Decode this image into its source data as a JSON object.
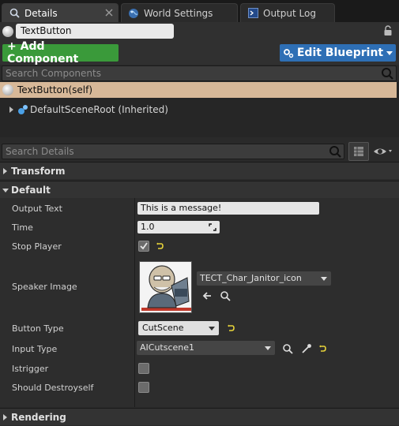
{
  "tabs": [
    {
      "label": "Details",
      "icon": "magnifier-icon",
      "active": true
    },
    {
      "label": "World Settings",
      "icon": "globe-icon",
      "active": false
    },
    {
      "label": "Output Log",
      "icon": "terminal-icon",
      "active": false
    }
  ],
  "object": {
    "name": "TextButton"
  },
  "toolbar": {
    "add_component": "+ Add Component",
    "edit_blueprint": "Edit Blueprint"
  },
  "components_search": {
    "placeholder": "Search Components"
  },
  "tree": {
    "self": "TextButton(self)",
    "root": "DefaultSceneRoot (Inherited)"
  },
  "details_search": {
    "placeholder": "Search Details"
  },
  "categories": {
    "transform": "Transform",
    "default": "Default",
    "rendering": "Rendering"
  },
  "props": {
    "output_text": {
      "label": "Output Text",
      "value": "This is a message!"
    },
    "time": {
      "label": "Time",
      "value": "1.0"
    },
    "stop_player": {
      "label": "Stop Player",
      "checked": true
    },
    "speaker_image": {
      "label": "Speaker Image",
      "asset": "TECT_Char_Janitor_icon"
    },
    "button_type": {
      "label": "Button Type",
      "value": "CutScene"
    },
    "input_type": {
      "label": "Input Type",
      "value": "AICutscene1"
    },
    "istrigger": {
      "label": "Istrigger",
      "checked": false
    },
    "should_destroyself": {
      "label": "Should Destroyself",
      "checked": false
    }
  },
  "colors": {
    "add_green": "#3a9a3a",
    "edit_blue": "#2e6fb5",
    "selected_row": "#d7b898",
    "reset_yellow": "#e8d43a"
  }
}
